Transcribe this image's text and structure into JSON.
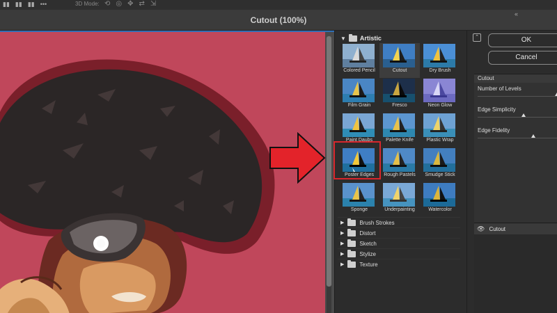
{
  "app": {
    "window_title": "Cutout (100%)",
    "mode_label": "3D Mode:",
    "collapse_glyph": "«"
  },
  "gallery": {
    "category_open": "Artistic",
    "filters": [
      {
        "label": "Colored Pencil"
      },
      {
        "label": "Cutout"
      },
      {
        "label": "Dry Brush"
      },
      {
        "label": "Film Grain"
      },
      {
        "label": "Fresco"
      },
      {
        "label": "Neon Glow"
      },
      {
        "label": "Paint Daubs"
      },
      {
        "label": "Palette Knife"
      },
      {
        "label": "Plastic Wrap"
      },
      {
        "label": "Poster Edges"
      },
      {
        "label": "Rough Pastels"
      },
      {
        "label": "Smudge Stick"
      },
      {
        "label": "Sponge"
      },
      {
        "label": "Underpainting"
      },
      {
        "label": "Watercolor"
      }
    ],
    "selected": "Cutout",
    "highlighted": "Poster Edges",
    "other_categories": [
      "Brush Strokes",
      "Distort",
      "Sketch",
      "Stylize",
      "Texture"
    ]
  },
  "panel": {
    "ok_label": "OK",
    "cancel_label": "Cancel",
    "filter_select": "Cutout",
    "params": [
      {
        "label": "Number of Levels"
      },
      {
        "label": "Edge Simplicity"
      },
      {
        "label": "Edge Fidelity"
      }
    ],
    "layer_name": "Cutout"
  },
  "colors": {
    "canvas_bg": "#c0475b",
    "accent_red": "#e3232a",
    "highlight_border": "#d8262c"
  },
  "icons": [
    "move-icon",
    "align-icon",
    "more-icon",
    "orbit-icon",
    "roll-icon",
    "pan-icon",
    "slide-icon",
    "scale-icon",
    "folder-icon",
    "eye-icon",
    "collapse-icon"
  ]
}
